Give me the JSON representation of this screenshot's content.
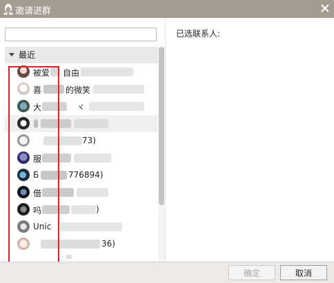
{
  "window": {
    "title": "邀请进群"
  },
  "search": {
    "value": "",
    "placeholder": ""
  },
  "group": {
    "label": "最近"
  },
  "contacts": [
    {
      "name": "被爱",
      "name2": "自由"
    },
    {
      "name": "喜",
      "name2": "的微笑"
    },
    {
      "name": "",
      "name2": "ヾ"
    },
    {
      "name": "",
      "name2": ""
    },
    {
      "name": "",
      "name2": "73)"
    },
    {
      "name": "",
      "name2": ""
    },
    {
      "name": "",
      "name2": "776894)"
    },
    {
      "name": "",
      "name2": ""
    },
    {
      "name": "",
      "name2": ""
    },
    {
      "name": "Unic",
      "name2": ""
    },
    {
      "name": "",
      "name2": "36)"
    }
  ],
  "right": {
    "selected_label": "已选联系人:"
  },
  "footer": {
    "ok_label": "确定",
    "cancel_label": "取消"
  }
}
